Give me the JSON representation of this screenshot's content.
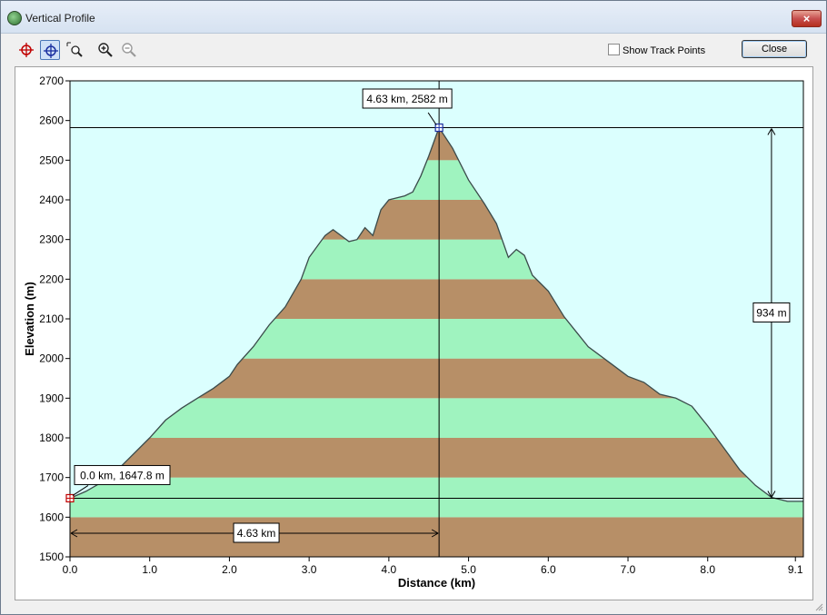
{
  "window": {
    "title": "Vertical Profile",
    "close_glyph": "×"
  },
  "toolbar": {
    "tools": [
      {
        "name": "crosshair-red-icon"
      },
      {
        "name": "crosshair-blue-icon",
        "active": true
      },
      {
        "name": "zoom-window-icon"
      },
      {
        "name": "zoom-in-icon"
      },
      {
        "name": "zoom-out-icon"
      }
    ],
    "show_track_points_label": "Show Track Points",
    "show_track_points_checked": false,
    "close_label": "Close"
  },
  "colors": {
    "sky": "#dbfffe",
    "band_brown": "#b78f67",
    "band_green": "#9ff3bf",
    "profile_line": "#3a4a4a"
  },
  "chart_data": {
    "type": "area",
    "xlabel": "Distance  (km)",
    "ylabel": "Elevation  (m)",
    "xlim": [
      0,
      9.2
    ],
    "ylim": [
      1500,
      2700
    ],
    "x_ticks": [
      "0.0",
      "1.0",
      "2.0",
      "3.0",
      "4.0",
      "5.0",
      "6.0",
      "7.0",
      "8.0",
      "9.1"
    ],
    "x_tick_values": [
      0,
      1,
      2,
      3,
      4,
      5,
      6,
      7,
      8,
      9.1
    ],
    "y_ticks": [
      "1500",
      "1600",
      "1700",
      "1800",
      "1900",
      "2000",
      "2100",
      "2200",
      "2300",
      "2400",
      "2500",
      "2600",
      "2700"
    ],
    "y_tick_values": [
      1500,
      1600,
      1700,
      1800,
      1900,
      2000,
      2100,
      2200,
      2300,
      2400,
      2500,
      2600,
      2700
    ],
    "band_step_m": 100,
    "profile": {
      "x": [
        0,
        0.2,
        0.5,
        0.7,
        1.0,
        1.2,
        1.4,
        1.6,
        1.8,
        2.0,
        2.1,
        2.3,
        2.5,
        2.7,
        2.9,
        3.0,
        3.2,
        3.3,
        3.5,
        3.6,
        3.7,
        3.8,
        3.9,
        4.0,
        4.2,
        4.3,
        4.4,
        4.5,
        4.63,
        4.8,
        5.0,
        5.2,
        5.35,
        5.5,
        5.6,
        5.7,
        5.8,
        6.0,
        6.2,
        6.5,
        6.8,
        7.0,
        7.2,
        7.4,
        7.6,
        7.8,
        8.0,
        8.2,
        8.4,
        8.6,
        8.8,
        9.0,
        9.1
      ],
      "y": [
        1647.8,
        1665,
        1700,
        1740,
        1800,
        1845,
        1875,
        1900,
        1925,
        1955,
        1985,
        2030,
        2085,
        2130,
        2200,
        2255,
        2310,
        2325,
        2295,
        2300,
        2330,
        2310,
        2375,
        2400,
        2410,
        2420,
        2460,
        2510,
        2582,
        2530,
        2450,
        2390,
        2340,
        2255,
        2275,
        2260,
        2210,
        2170,
        2105,
        2030,
        1985,
        1955,
        1940,
        1910,
        1900,
        1880,
        1830,
        1775,
        1720,
        1680,
        1650,
        1640,
        1640
      ]
    },
    "annotations": {
      "peak_label": "4.63 km, 2582 m",
      "peak": {
        "x": 4.63,
        "y": 2582
      },
      "start_label": "0.0 km, 1647.8 m",
      "start": {
        "x": 0.0,
        "y": 1647.8
      },
      "distance_label": "4.63 km",
      "elevation_diff_label": "934 m",
      "elevation_diff_x": 8.8
    }
  }
}
